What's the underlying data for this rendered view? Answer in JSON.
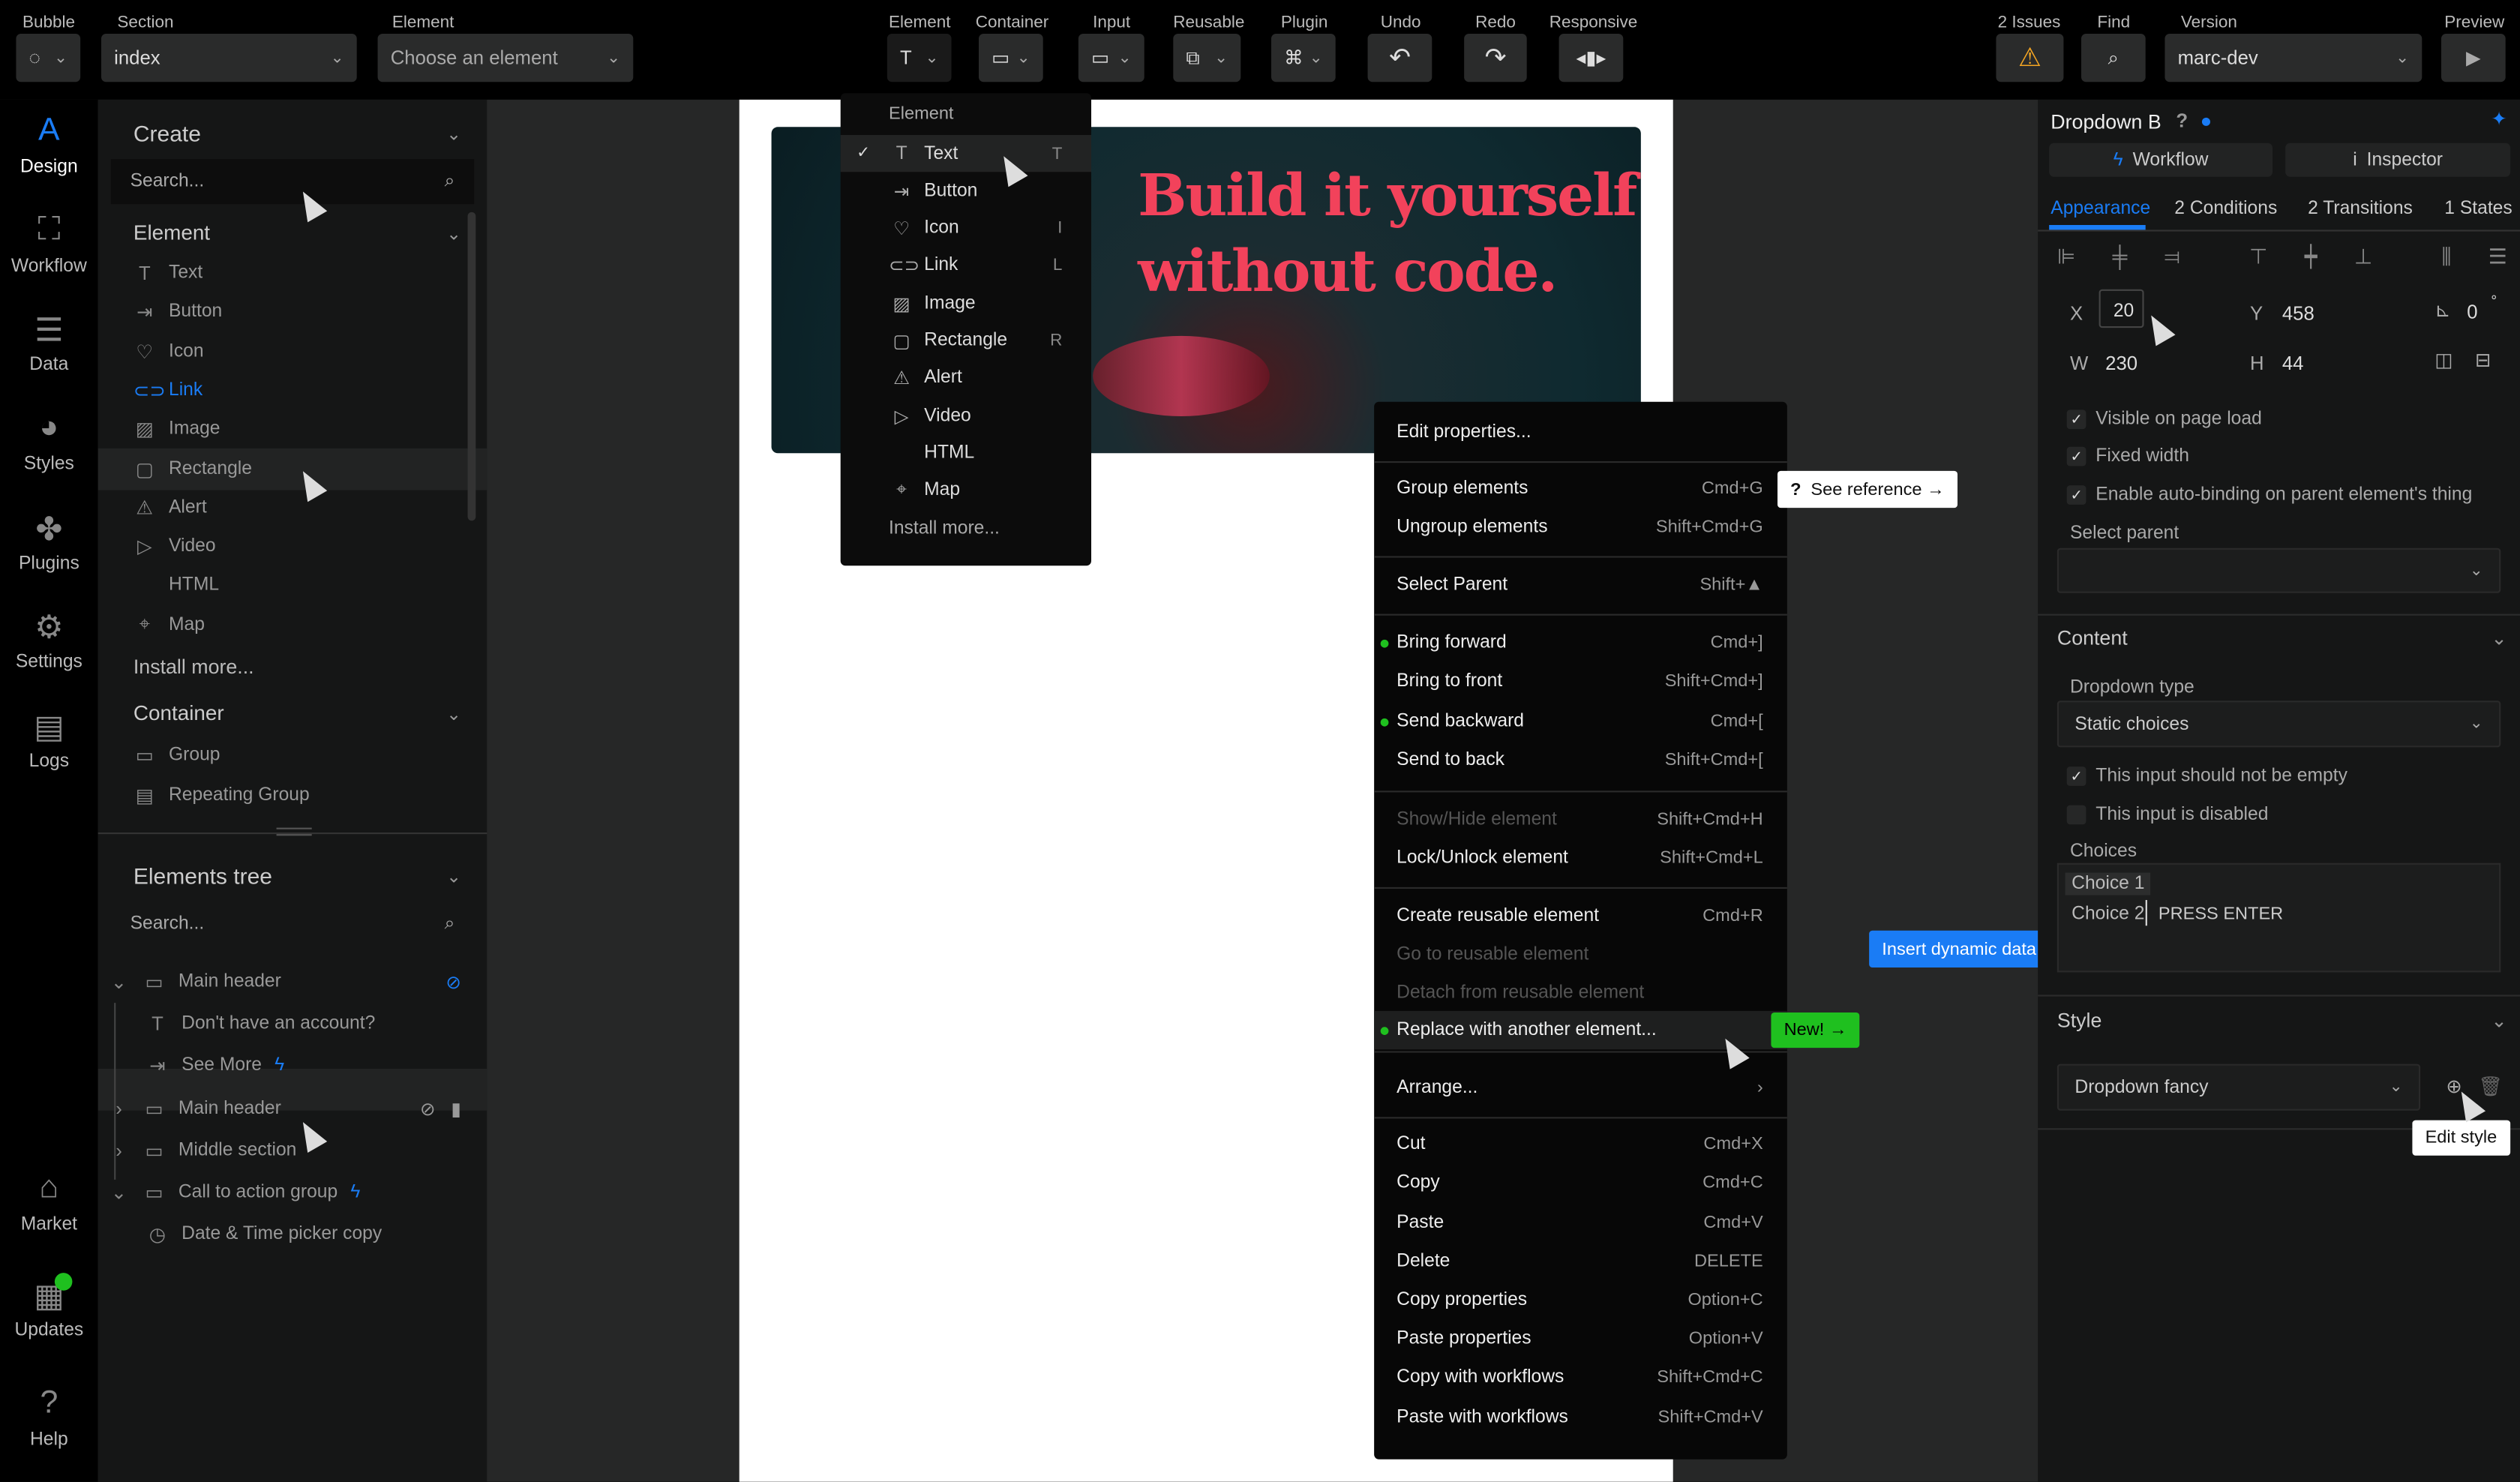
{
  "topbar": {
    "bubble_label": "Bubble",
    "section_label": "Section",
    "section_value": "index",
    "element_label": "Element",
    "element_placeholder": "Choose an element",
    "tools": [
      {
        "label": "Element",
        "icon": "text-icon"
      },
      {
        "label": "Container",
        "icon": "folder-icon"
      },
      {
        "label": "Input",
        "icon": "input-icon"
      },
      {
        "label": "Reusable",
        "icon": "reusable-icon"
      },
      {
        "label": "Plugin",
        "icon": "plugin-icon"
      },
      {
        "label": "Undo",
        "icon": "undo-icon"
      },
      {
        "label": "Redo",
        "icon": "redo-icon"
      },
      {
        "label": "Responsive",
        "icon": "responsive-icon"
      }
    ],
    "issues_label": "2 Issues",
    "find_label": "Find",
    "version_label": "Version",
    "version_value": "marc-dev",
    "preview_label": "Preview"
  },
  "rail": [
    {
      "label": "Design"
    },
    {
      "label": "Workflow"
    },
    {
      "label": "Data"
    },
    {
      "label": "Styles"
    },
    {
      "label": "Plugins"
    },
    {
      "label": "Settings"
    },
    {
      "label": "Logs"
    },
    {
      "label": "Market"
    },
    {
      "label": "Updates"
    },
    {
      "label": "Help"
    }
  ],
  "left": {
    "create_title": "Create",
    "search_placeholder": "Search...",
    "element_section": "Element",
    "elements": [
      "Text",
      "Button",
      "Icon",
      "Link",
      "Image",
      "Rectangle",
      "Alert",
      "Video",
      "HTML",
      "Map"
    ],
    "install_more": "Install more...",
    "container_section": "Container",
    "containers": [
      "Group",
      "Repeating Group"
    ],
    "tree_title": "Elements tree",
    "tree_search_placeholder": "Search...",
    "tree": [
      "Main header",
      "Don't have an account?",
      "See More",
      "Main header",
      "Middle section",
      "Call to action group",
      "Date & Time picker copy"
    ]
  },
  "hero": {
    "headline_1": "Build it yourself",
    "headline_2": "without code."
  },
  "element_menu": {
    "title": "Element",
    "items": [
      {
        "label": "Text",
        "key": "T"
      },
      {
        "label": "Button",
        "key": ""
      },
      {
        "label": "Icon",
        "key": "I"
      },
      {
        "label": "Link",
        "key": "L"
      },
      {
        "label": "Image",
        "key": ""
      },
      {
        "label": "Rectangle",
        "key": "R"
      },
      {
        "label": "Alert",
        "key": ""
      },
      {
        "label": "Video",
        "key": ""
      },
      {
        "label": "HTML",
        "key": ""
      },
      {
        "label": "Map",
        "key": ""
      }
    ],
    "install_more": "Install more..."
  },
  "context_menu": [
    {
      "label": "Edit properties...",
      "key": ""
    },
    {
      "label": "Group elements",
      "key": "Cmd+G"
    },
    {
      "label": "Ungroup elements",
      "key": "Shift+Cmd+G"
    },
    {
      "label": "Select Parent",
      "key": "Shift+▲"
    },
    {
      "label": "Bring forward",
      "key": "Cmd+]"
    },
    {
      "label": "Bring to front",
      "key": "Shift+Cmd+]"
    },
    {
      "label": "Send backward",
      "key": "Cmd+["
    },
    {
      "label": "Send to back",
      "key": "Shift+Cmd+["
    },
    {
      "label": "Show/Hide element",
      "key": "Shift+Cmd+H"
    },
    {
      "label": "Lock/Unlock element",
      "key": "Shift+Cmd+L"
    },
    {
      "label": "Create reusable element",
      "key": "Cmd+R"
    },
    {
      "label": "Go to reusable element",
      "key": ""
    },
    {
      "label": "Detach from reusable element",
      "key": ""
    },
    {
      "label": "Replace with another element...",
      "key": ""
    },
    {
      "label": "Arrange...",
      "key": "›"
    },
    {
      "label": "Cut",
      "key": "Cmd+X"
    },
    {
      "label": "Copy",
      "key": "Cmd+C"
    },
    {
      "label": "Paste",
      "key": "Cmd+V"
    },
    {
      "label": "Delete",
      "key": "DELETE"
    },
    {
      "label": "Copy properties",
      "key": "Option+C"
    },
    {
      "label": "Paste properties",
      "key": "Option+V"
    },
    {
      "label": "Copy with workflows",
      "key": "Shift+Cmd+C"
    },
    {
      "label": "Paste with workflows",
      "key": "Shift+Cmd+V"
    }
  ],
  "tooltips": {
    "see_reference": "See reference →",
    "new": "New! →",
    "insert_dynamic": "Insert dynamic data",
    "edit_style": "Edit style"
  },
  "right": {
    "title": "Dropdown B",
    "workflow_btn": "Workflow",
    "inspector_btn": "Inspector",
    "tabs": [
      "Appearance",
      "2 Conditions",
      "2 Transitions",
      "1 States"
    ],
    "x": "20",
    "y": "458",
    "w": "230",
    "h": "44",
    "rotation": "0",
    "x_label": "X",
    "y_label": "Y",
    "w_label": "W",
    "h_label": "H",
    "checks": [
      "Visible on page load",
      "Fixed width",
      "Enable auto-binding on parent element's thing"
    ],
    "select_parent": "Select parent",
    "content_title": "Content",
    "dropdown_type_label": "Dropdown type",
    "dropdown_type": "Static choices",
    "not_empty": "This input should not be empty",
    "disabled": "This input is disabled",
    "choices_label": "Choices",
    "choice1": "Choice 1",
    "choice2": "Choice 2",
    "press_enter": "PRESS ENTER",
    "style_title": "Style",
    "style_value": "Dropdown fancy"
  },
  "colors": {
    "accent": "#1a7cf5",
    "green": "#1fc01f",
    "warning": "#f5a623",
    "headline": "#f2425b"
  }
}
